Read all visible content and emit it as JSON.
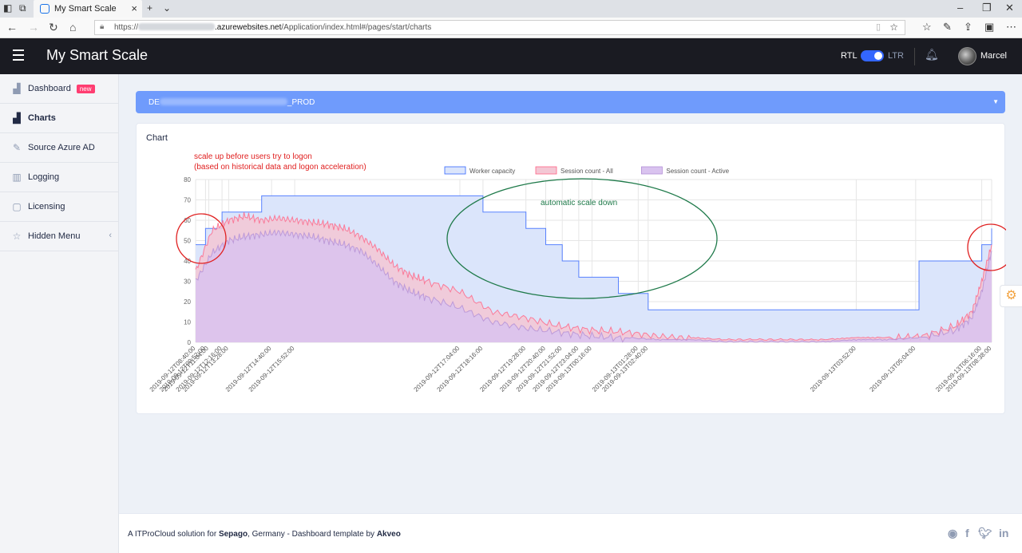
{
  "browser": {
    "tab_title": "My Smart Scale",
    "url_prefix": "https://",
    "url_host": ".azurewebsites.net",
    "url_path": "/Application/index.html#/pages/start/charts"
  },
  "header": {
    "title": "My Smart Scale",
    "rtl_label": "RTL",
    "ltr_label": "LTR",
    "user_name": "Marcel"
  },
  "sidebar": {
    "items": [
      {
        "label": "Dashboard",
        "icon": "chart-icon",
        "badge": "new"
      },
      {
        "label": "Charts",
        "icon": "chart-icon"
      },
      {
        "label": "Source Azure AD",
        "icon": "edit-icon"
      },
      {
        "label": "Logging",
        "icon": "columns-icon"
      },
      {
        "label": "Licensing",
        "icon": "shopping-bag-icon"
      },
      {
        "label": "Hidden Menu",
        "icon": "star-icon"
      }
    ]
  },
  "selector": {
    "value_prefix": "DE",
    "value_suffix": "_PROD"
  },
  "card": {
    "title": "Chart"
  },
  "annotations": {
    "scale_up_line1": "scale up before users try to logon",
    "scale_up_line2": "(based on historical data and logon acceleration)",
    "scale_down": "automatic scale down",
    "red_color": "#e02020",
    "green_color": "#1f7a4a"
  },
  "chart_data": {
    "type": "area",
    "ylim": [
      0,
      80
    ],
    "yticks": [
      0,
      10,
      20,
      30,
      40,
      50,
      60,
      70,
      80
    ],
    "legend": {
      "position": "top-center"
    },
    "xtick_labels": [
      "2019-09-12T08:40:00",
      "2019-09-12T09:52:00",
      "2019-09-12T11:04:00",
      "2019-09-12T12:16:00",
      "2019-09-12T13:28:00",
      "2019-09-12T14:40:00",
      "2019-09-12T15:52:00",
      "2019-09-12T17:04:00",
      "2019-09-12T18:16:00",
      "2019-09-12T19:28:00",
      "2019-09-12T20:40:00",
      "2019-09-12T21:52:00",
      "2019-09-12T23:04:00",
      "2019-09-13T00:16:00",
      "2019-09-13T01:28:00",
      "2019-09-13T02:40:00",
      "2019-09-13T03:52:00",
      "2019-09-13T05:04:00",
      "2019-09-13T06:16:00",
      "2019-09-13T08:38:00"
    ],
    "x_hours": [
      0,
      0.3,
      0.4,
      0.8,
      1.0,
      2.3,
      3.0,
      8.0,
      8.7,
      10.0,
      10.6,
      11.1,
      11.6,
      12.0,
      13.4,
      13.7,
      20.0,
      21.8,
      23.8,
      24.1
    ],
    "series": [
      {
        "name": "Worker capacity",
        "color": "#3366ff",
        "fill": "#dbe5fb",
        "x_hours": [
          0,
          0.3,
          0.8,
          1.2,
          2.0,
          3.0,
          4.5,
          6.0,
          8.0,
          8.7,
          9.3,
          10.0,
          10.6,
          11.1,
          11.6,
          12.2,
          12.8,
          13.4,
          13.7,
          16.0,
          18.0,
          20.0,
          21.8,
          21.9,
          23.5,
          23.8,
          24.1
        ],
        "values": [
          48,
          56,
          64,
          64,
          72,
          72,
          72,
          72,
          72,
          64,
          64,
          56,
          48,
          40,
          32,
          32,
          24,
          24,
          16,
          16,
          16,
          16,
          16,
          40,
          40,
          48,
          56
        ]
      },
      {
        "name": "Session count - All",
        "color": "#ff6384",
        "fill": "#f3c7d4",
        "x_hours": [
          0,
          0.5,
          1.0,
          1.5,
          2.0,
          2.5,
          3.0,
          3.5,
          4.0,
          4.5,
          5.0,
          5.5,
          6.0,
          6.5,
          7.0,
          8.0,
          9.0,
          10.0,
          11.0,
          12.0,
          13.0,
          14.0,
          15.0,
          16.0,
          17.0,
          18.0,
          19.0,
          20.0,
          21.0,
          22.0,
          23.0,
          23.5,
          23.8,
          24.1
        ],
        "values": [
          35,
          55,
          60,
          62,
          60,
          61,
          60,
          59,
          58,
          56,
          52,
          46,
          38,
          33,
          30,
          25,
          15,
          12,
          8,
          6,
          5,
          3,
          2,
          1,
          1,
          1,
          1,
          2,
          2,
          3,
          8,
          15,
          30,
          48
        ]
      },
      {
        "name": "Session count - Active",
        "color": "#b38ed6",
        "fill": "#d9c3ef",
        "x_hours": [
          0,
          0.5,
          1.0,
          1.5,
          2.0,
          2.5,
          3.0,
          3.5,
          4.0,
          4.5,
          5.0,
          5.5,
          6.0,
          6.5,
          7.0,
          8.0,
          9.0,
          10.0,
          11.0,
          12.0,
          13.0,
          14.0,
          15.0,
          16.0,
          17.0,
          18.0,
          19.0,
          20.0,
          21.0,
          22.0,
          23.0,
          23.5,
          23.8,
          24.1
        ],
        "values": [
          30,
          44,
          50,
          52,
          53,
          54,
          53,
          52,
          50,
          48,
          45,
          38,
          30,
          25,
          22,
          17,
          10,
          7,
          5,
          3,
          2,
          1,
          1,
          0,
          0,
          0,
          0,
          1,
          1,
          2,
          6,
          12,
          25,
          45
        ]
      }
    ]
  }
}
